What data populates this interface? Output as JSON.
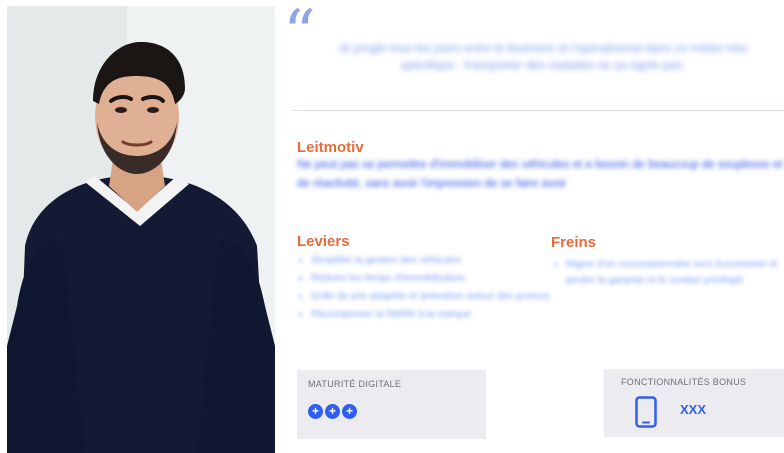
{
  "quote": {
    "mark": "“",
    "text": "Je jongle tous les jours entre le business et l'opérationnel dans ce métier très spécifique : transporter des malades ne ça rigole pas."
  },
  "leitmotiv": {
    "title": "Leitmotiv",
    "text": "Ne peut pas se permettre d'immobiliser des véhicules et a besoin de beaucoup de souplesse et de réactivité, sans avoir l'impression de se faire avoir"
  },
  "leviers": {
    "title": "Leviers",
    "items": [
      "Simplifier la gestion des véhicules",
      "Réduire les temps d'immobilisation",
      "Grille de prix adaptée et animation autour des promos",
      "Récompenser la fidélité à la marque"
    ]
  },
  "freins": {
    "title": "Freins",
    "items": [
      "Migrer d'un concessionnaire vers Euromaster et perdre la garantie et le contact privilégié"
    ]
  },
  "maturite": {
    "title": "MATURITÉ DIGITALE",
    "dots": [
      "+",
      "+",
      "+"
    ],
    "accent": "#2f5ef0"
  },
  "bonus": {
    "title": "FONCTIONNALITÉS BONUS",
    "icon": "smartphone-icon",
    "value": "XXX",
    "accent": "#2f5ef0"
  },
  "colors": {
    "heading": "#e86b3a",
    "leitmotiv_text": "#2f55e5",
    "bullets": "#7fa0f0",
    "card_bg": "#ececf0"
  }
}
